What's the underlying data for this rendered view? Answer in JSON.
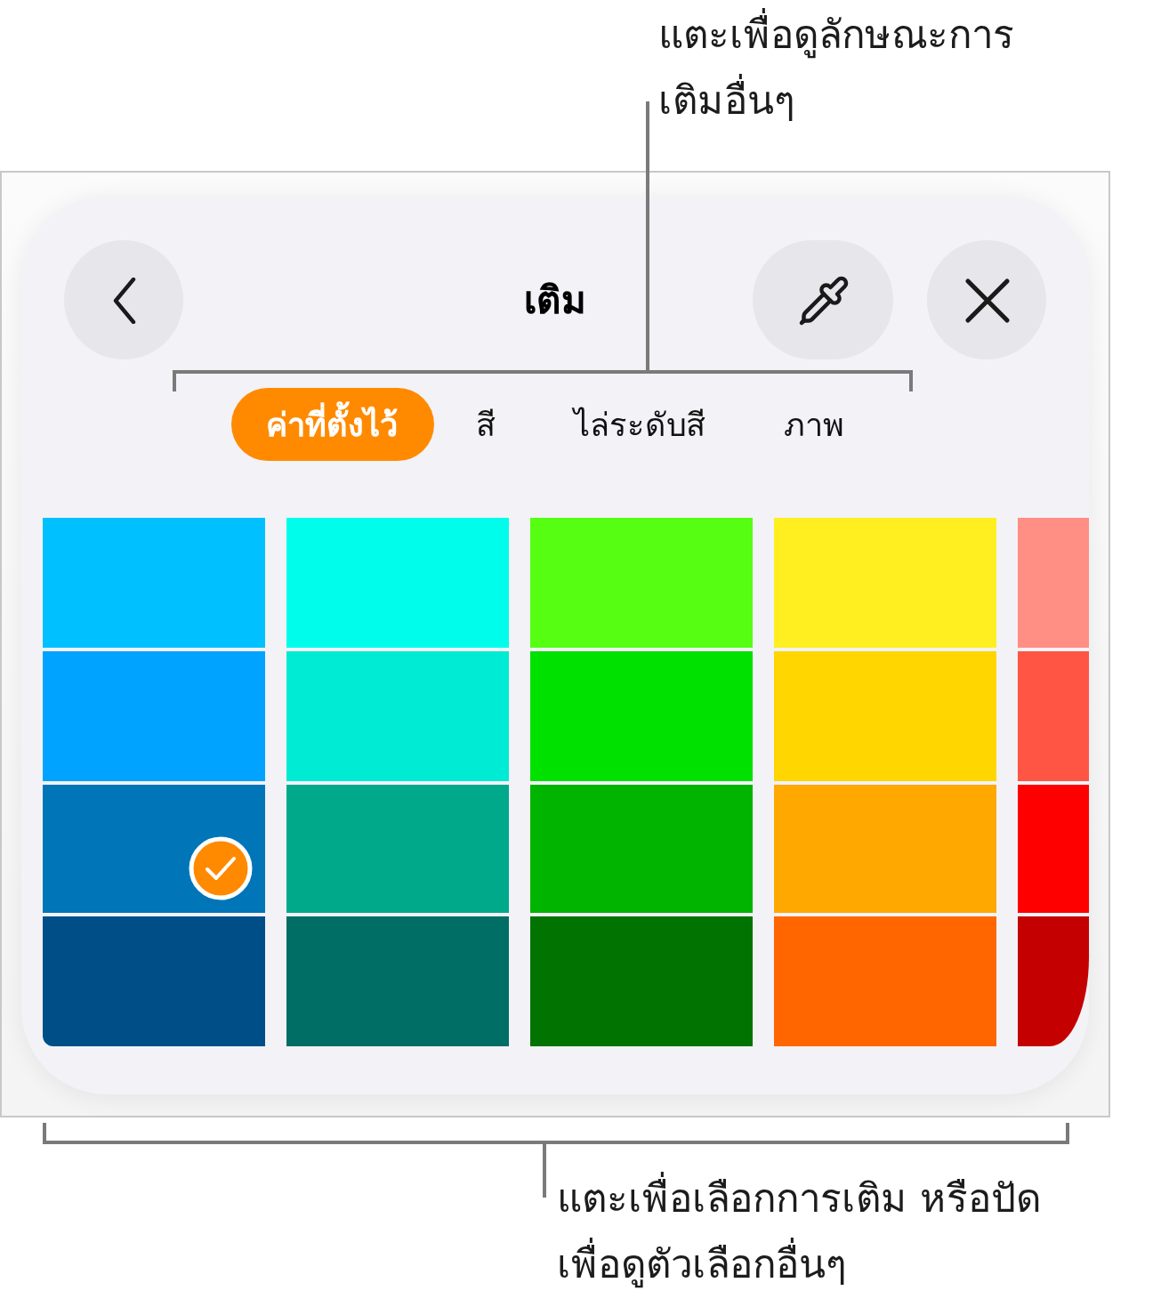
{
  "top_callout": {
    "lines": [
      "แตะเพื่อดูลักษณะการ",
      "เติมอื่นๆ"
    ]
  },
  "panel": {
    "title": "เติม",
    "tabs": [
      {
        "label": "ค่าที่ตั้งไว้",
        "selected": true
      },
      {
        "label": "สี",
        "selected": false
      },
      {
        "label": "ไล่ระดับสี",
        "selected": false
      },
      {
        "label": "ภาพ",
        "selected": false
      }
    ],
    "swatch_columns": [
      {
        "swatches": [
          {
            "color": "#00c0ff",
            "selected": false
          },
          {
            "color": "#00a3ff",
            "selected": false
          },
          {
            "color": "#0075b8",
            "selected": true
          },
          {
            "color": "#004e88",
            "selected": false
          }
        ]
      },
      {
        "swatches": [
          {
            "color": "#00fdeb",
            "selected": false
          },
          {
            "color": "#00ebd3",
            "selected": false
          },
          {
            "color": "#00a98a",
            "selected": false
          },
          {
            "color": "#006e64",
            "selected": false
          }
        ]
      },
      {
        "swatches": [
          {
            "color": "#56ff12",
            "selected": false
          },
          {
            "color": "#00e100",
            "selected": false
          },
          {
            "color": "#00b400",
            "selected": false
          },
          {
            "color": "#007300",
            "selected": false
          }
        ]
      },
      {
        "swatches": [
          {
            "color": "#ffee20",
            "selected": false
          },
          {
            "color": "#ffd600",
            "selected": false
          },
          {
            "color": "#ffa800",
            "selected": false
          },
          {
            "color": "#ff6600",
            "selected": false
          }
        ]
      },
      {
        "swatches": [
          {
            "color": "#ff8e85",
            "selected": false
          },
          {
            "color": "#ff5544",
            "selected": false
          },
          {
            "color": "#ff0000",
            "selected": false
          },
          {
            "color": "#c40000",
            "selected": false
          }
        ]
      }
    ]
  },
  "bottom_callout": {
    "lines": [
      "แตะเพื่อเลือกการเติม หรือปัด",
      "เพื่อดูตัวเลือกอื่นๆ"
    ]
  }
}
